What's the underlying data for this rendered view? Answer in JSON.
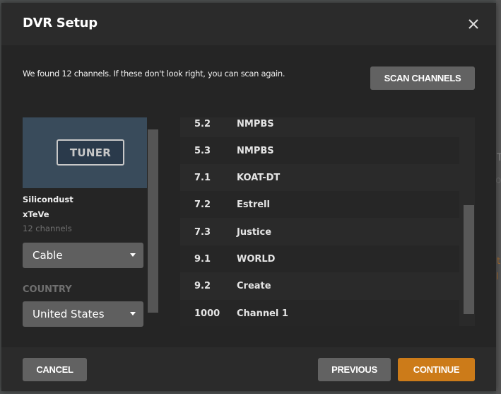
{
  "dialog": {
    "title": "DVR Setup",
    "close_icon": "close-icon"
  },
  "notice": "We found 12 channels. If these don't look right, you can scan again.",
  "scan_button": "SCAN CHANNELS",
  "device": {
    "image_label": "TUNER",
    "name": "Silicondust",
    "model": "xTeVe",
    "channel_count": "12 channels",
    "type_select": {
      "value": "Cable"
    },
    "country_label": "COUNTRY",
    "country_select": {
      "value": "United States"
    }
  },
  "channels": [
    {
      "number": "5.2",
      "name": "NMPBS"
    },
    {
      "number": "5.3",
      "name": "NMPBS"
    },
    {
      "number": "7.1",
      "name": "KOAT-DT"
    },
    {
      "number": "7.2",
      "name": "Estrell"
    },
    {
      "number": "7.3",
      "name": "Justice"
    },
    {
      "number": "9.1",
      "name": "WORLD"
    },
    {
      "number": "9.2",
      "name": "Create"
    },
    {
      "number": "1000",
      "name": "Channel 1"
    }
  ],
  "footer": {
    "cancel": "CANCEL",
    "previous": "PREVIOUS",
    "continue": "CONTINUE"
  },
  "colors": {
    "accent": "#cc7b19",
    "button_gray": "#626262",
    "tuner_bg": "#394b5b"
  }
}
